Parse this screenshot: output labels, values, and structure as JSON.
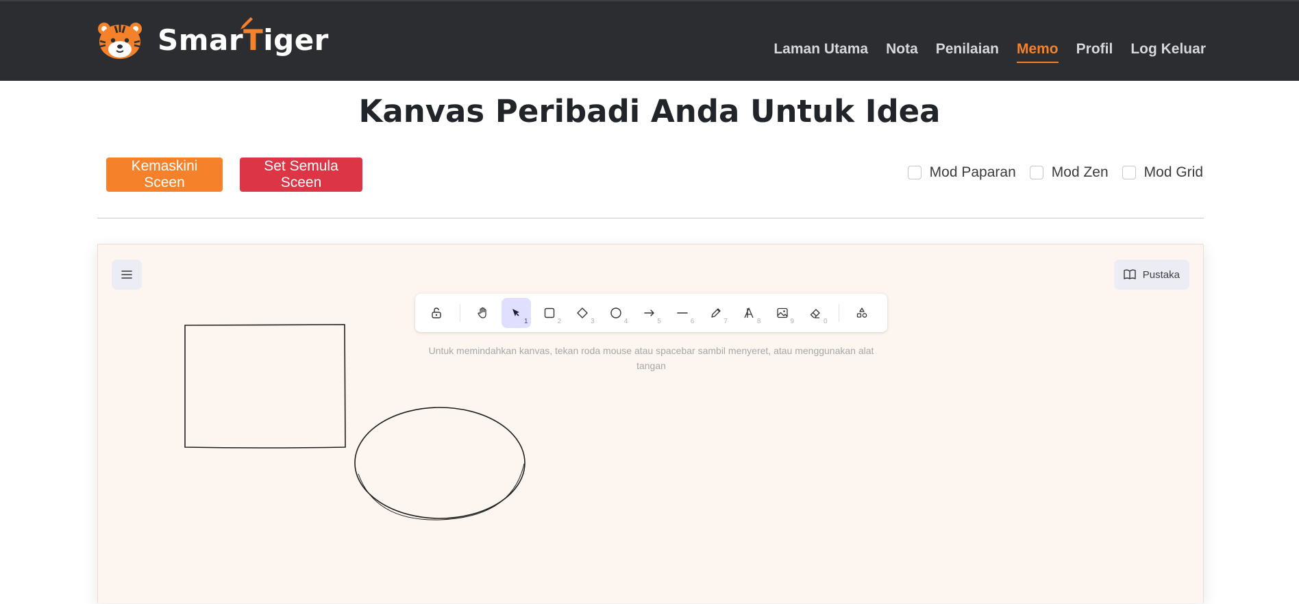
{
  "header": {
    "logo_text_before": "Smar",
    "logo_text_accent": "T",
    "logo_text_after": "iger",
    "nav": [
      {
        "label": "Laman Utama",
        "active": false
      },
      {
        "label": "Nota",
        "active": false
      },
      {
        "label": "Penilaian",
        "active": false
      },
      {
        "label": "Memo",
        "active": true
      },
      {
        "label": "Profil",
        "active": false
      },
      {
        "label": "Log Keluar",
        "active": false
      }
    ]
  },
  "main": {
    "title": "Kanvas Peribadi Anda Untuk Idea",
    "update_button": "Kemaskini Sceen",
    "reset_button": "Set Semula Sceen",
    "options": [
      {
        "label": "Mod Paparan",
        "checked": false
      },
      {
        "label": "Mod Zen",
        "checked": false
      },
      {
        "label": "Mod Grid",
        "checked": false
      }
    ]
  },
  "canvas": {
    "library_label": "Pustaka",
    "hint": "Untuk memindahkan kanvas, tekan roda mouse atau spacebar sambil menyeret, atau menggunakan alat tangan",
    "tools": [
      {
        "icon": "lock-open-icon",
        "num": ""
      },
      {
        "icon": "hand-icon",
        "num": ""
      },
      {
        "icon": "pointer-icon",
        "num": "1",
        "active": true
      },
      {
        "icon": "rectangle-icon",
        "num": "2"
      },
      {
        "icon": "diamond-icon",
        "num": "3"
      },
      {
        "icon": "ellipse-icon",
        "num": "4"
      },
      {
        "icon": "arrow-icon",
        "num": "5"
      },
      {
        "icon": "line-icon",
        "num": "6"
      },
      {
        "icon": "pencil-icon",
        "num": "7"
      },
      {
        "icon": "text-icon",
        "num": "8"
      },
      {
        "icon": "image-icon",
        "num": "9"
      },
      {
        "icon": "eraser-icon",
        "num": "0"
      },
      {
        "icon": "shapes-icon",
        "num": ""
      }
    ]
  },
  "colors": {
    "header_bg": "#2b2d31",
    "accent": "#f5822a",
    "danger": "#dc3545",
    "canvas_bg": "#fdf5ef",
    "tool_active_bg": "#e0dfff"
  }
}
